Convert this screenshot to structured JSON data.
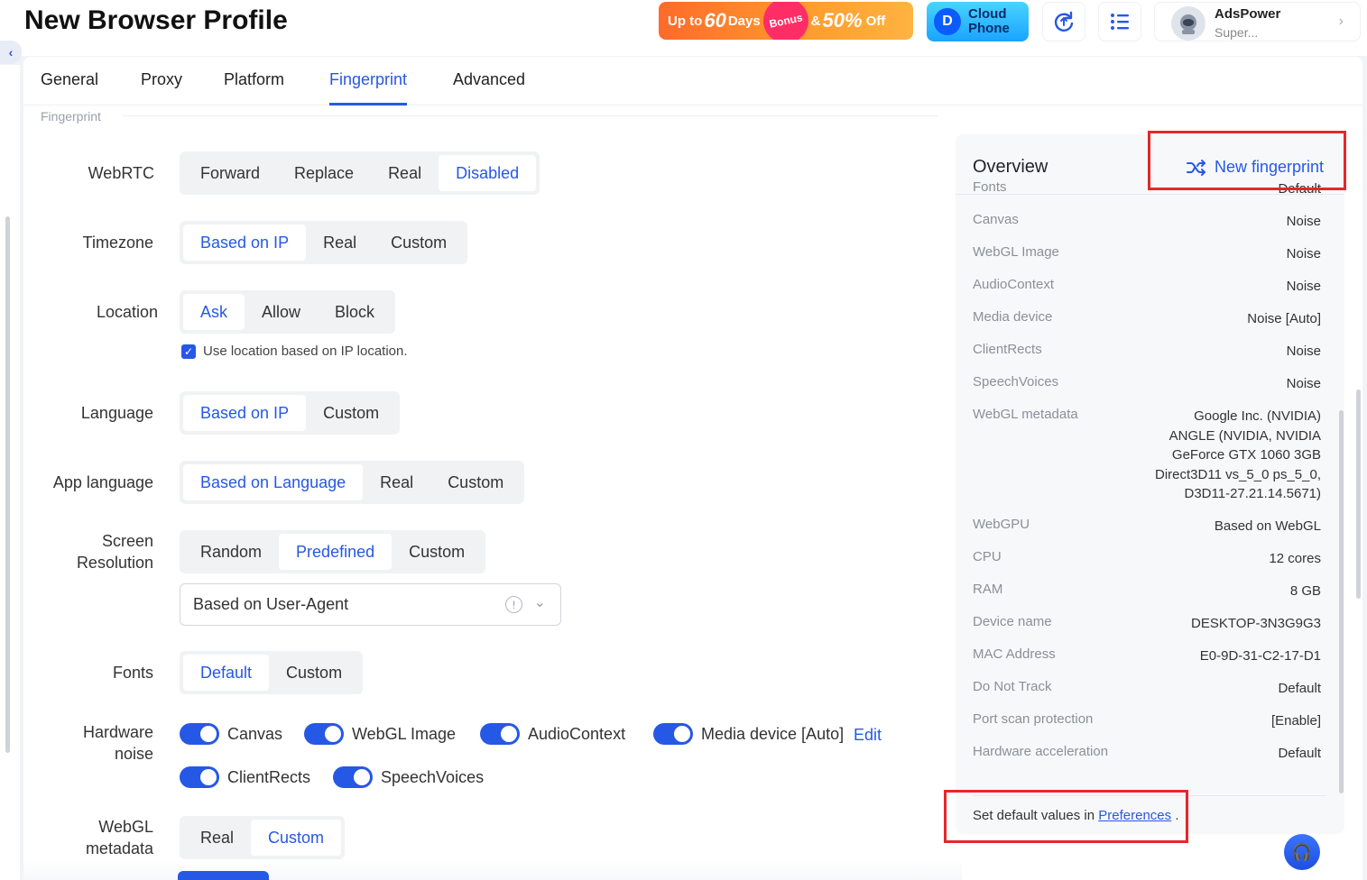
{
  "page_title": "New Browser Profile",
  "promo": {
    "up_to": "Up to",
    "days_num": "60",
    "days": "Days",
    "bonus": "Bonus",
    "amp": "&",
    "pct": "50%",
    "off": "Off"
  },
  "cloud_phone": {
    "line1": "Cloud",
    "line2": "Phone"
  },
  "account": {
    "name": "AdsPower",
    "role": "Super..."
  },
  "tabs": [
    "General",
    "Proxy",
    "Platform",
    "Fingerprint",
    "Advanced"
  ],
  "active_tab": "Fingerprint",
  "section_label": "Fingerprint",
  "settings": {
    "webrtc": {
      "label": "WebRTC",
      "options": [
        "Forward",
        "Replace",
        "Real",
        "Disabled"
      ],
      "selected": "Disabled"
    },
    "timezone": {
      "label": "Timezone",
      "options": [
        "Based on IP",
        "Real",
        "Custom"
      ],
      "selected": "Based on IP"
    },
    "location": {
      "label": "Location",
      "options": [
        "Ask",
        "Allow",
        "Block"
      ],
      "selected": "Ask",
      "checkbox_label": "Use location based on IP location.",
      "checkbox_checked": true
    },
    "language": {
      "label": "Language",
      "options": [
        "Based on IP",
        "Custom"
      ],
      "selected": "Based on IP"
    },
    "app_language": {
      "label": "App language",
      "options": [
        "Based on Language",
        "Real",
        "Custom"
      ],
      "selected": "Based on Language"
    },
    "screen_resolution": {
      "label_line1": "Screen",
      "label_line2": "Resolution",
      "options": [
        "Random",
        "Predefined",
        "Custom"
      ],
      "selected": "Predefined",
      "select_value": "Based on User-Agent"
    },
    "fonts": {
      "label": "Fonts",
      "options": [
        "Default",
        "Custom"
      ],
      "selected": "Default"
    },
    "hardware_noise": {
      "label_line1": "Hardware",
      "label_line2": "noise",
      "toggles": [
        "Canvas",
        "WebGL Image",
        "AudioContext",
        "Media device [Auto]",
        "ClientRects",
        "SpeechVoices"
      ],
      "edit_label": "Edit"
    },
    "webgl_metadata": {
      "label_line1": "WebGL",
      "label_line2": "metadata",
      "options": [
        "Real",
        "Custom"
      ],
      "selected": "Custom"
    }
  },
  "overview": {
    "title": "Overview",
    "new_fingerprint": "New fingerprint",
    "rows": [
      {
        "key": "Fonts",
        "value": "Default"
      },
      {
        "key": "Canvas",
        "value": "Noise"
      },
      {
        "key": "WebGL Image",
        "value": "Noise"
      },
      {
        "key": "AudioContext",
        "value": "Noise"
      },
      {
        "key": "Media device",
        "value": "Noise [Auto]"
      },
      {
        "key": "ClientRects",
        "value": "Noise"
      },
      {
        "key": "SpeechVoices",
        "value": "Noise"
      },
      {
        "key": "WebGL metadata",
        "value": "Google Inc. (NVIDIA)\nANGLE (NVIDIA, NVIDIA\nGeForce GTX 1060 3GB\nDirect3D11 vs_5_0 ps_5_0,\nD3D11-27.21.14.5671)"
      },
      {
        "key": "WebGPU",
        "value": "Based on WebGL"
      },
      {
        "key": "CPU",
        "value": "12 cores"
      },
      {
        "key": "RAM",
        "value": "8 GB"
      },
      {
        "key": "Device name",
        "value": "DESKTOP-3N3G9G3"
      },
      {
        "key": "MAC Address",
        "value": "E0-9D-31-C2-17-D1"
      },
      {
        "key": "Do Not Track",
        "value": "Default"
      },
      {
        "key": "Port scan protection",
        "value": "[Enable]"
      },
      {
        "key": "Hardware acceleration",
        "value": "Default"
      }
    ],
    "footer_prefix": "Set default values in",
    "footer_link": "Preferences",
    "footer_suffix": "."
  },
  "colors": {
    "accent": "#2658e6",
    "highlight": "#e8262a"
  }
}
